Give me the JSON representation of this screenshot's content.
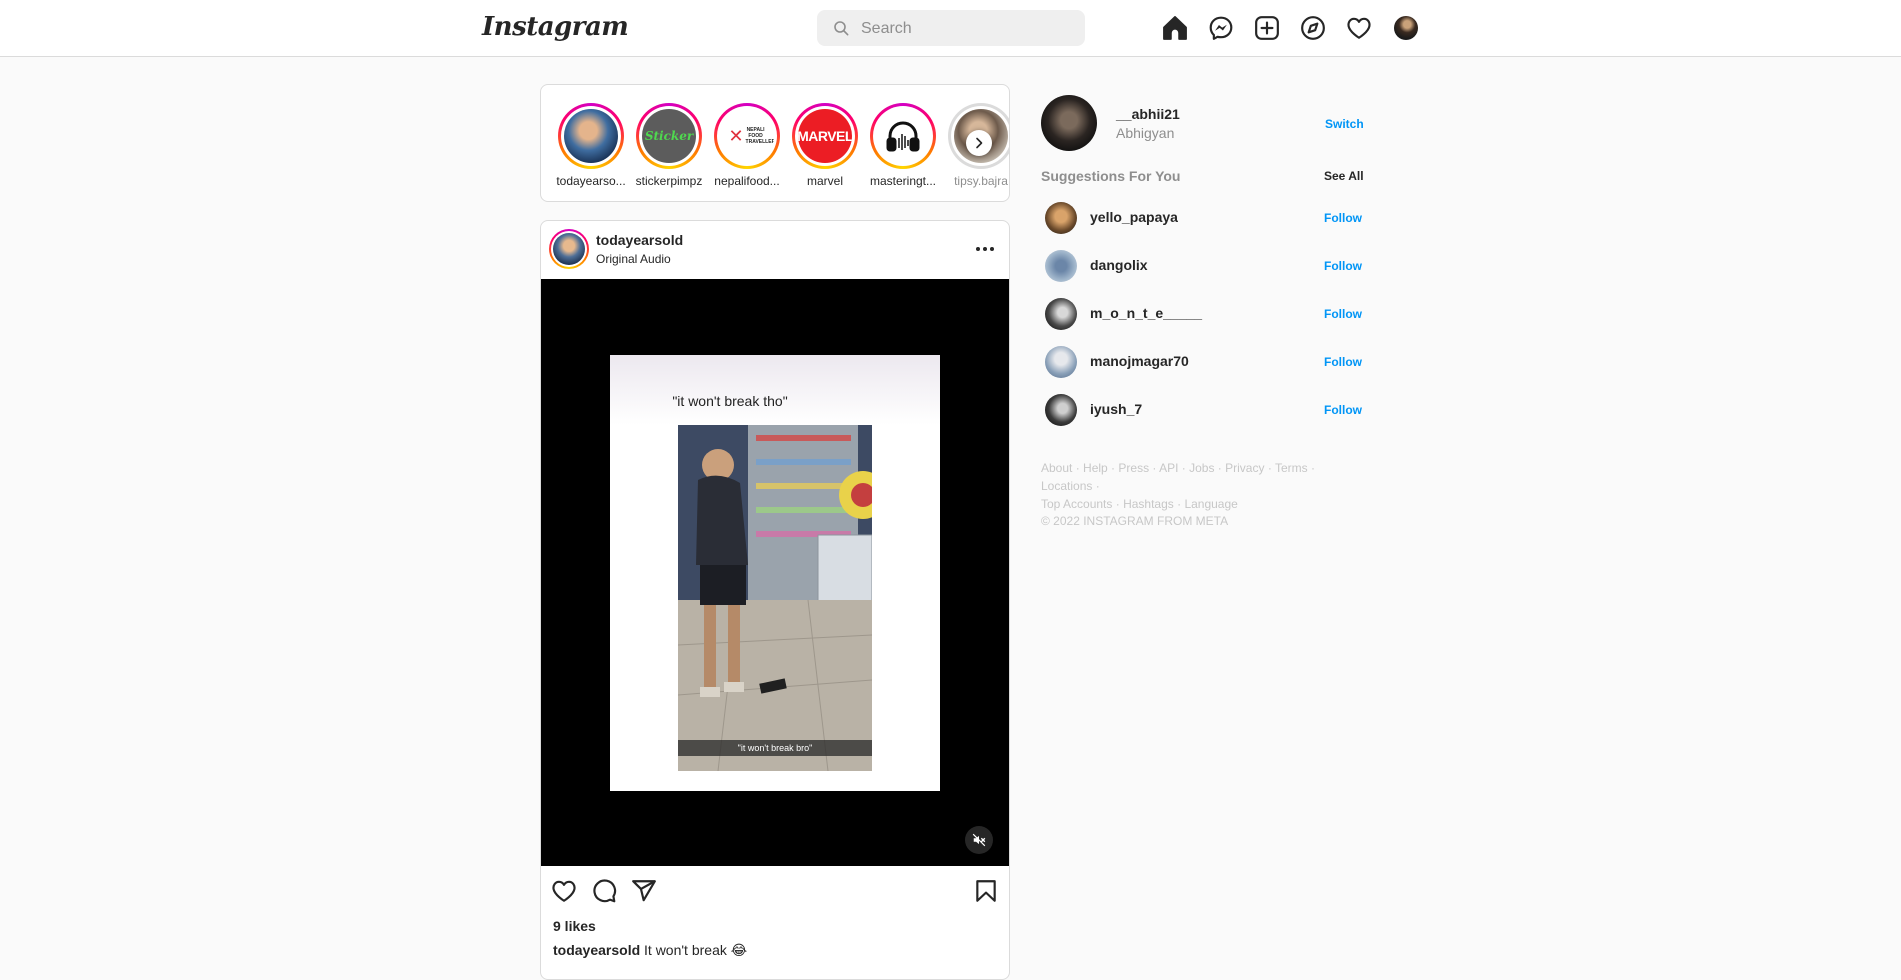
{
  "nav": {
    "logo": "Instagram",
    "search_placeholder": "Search",
    "icons": [
      "home-icon",
      "messenger-icon",
      "new-post-icon",
      "explore-icon",
      "activity-heart-icon",
      "profile-avatar"
    ]
  },
  "stories": [
    {
      "username": "todayearso...",
      "seen": false
    },
    {
      "username": "stickerpimpz",
      "seen": false
    },
    {
      "username": "nepalifood...",
      "seen": false
    },
    {
      "username": "marvel",
      "seen": false
    },
    {
      "username": "masteringt...",
      "seen": false
    },
    {
      "username": "tipsy.bajra",
      "seen": true
    }
  ],
  "story_logos": {
    "stickerpimpz": "Sticker",
    "nepalifood": "NEPALI FOOD TRAVELLER",
    "marvel": "MARVEL"
  },
  "post": {
    "username": "todayearsold",
    "subtitle": "Original Audio",
    "video_top_text": "\"it won't break tho\"",
    "video_subtitle": "\"it won't break bro\"",
    "likes": "9 likes",
    "caption_user": "todayearsold",
    "caption_text": "It won't break 😂"
  },
  "sidebar": {
    "username": "__abhii21",
    "full_name": "Abhigyan",
    "switch_label": "Switch",
    "suggestions_title": "Suggestions For You",
    "see_all_label": "See All",
    "suggestions": [
      {
        "username": "yello_papaya",
        "action": "Follow"
      },
      {
        "username": "dangolix",
        "action": "Follow"
      },
      {
        "username": "m_o_n_t_e_____",
        "action": "Follow"
      },
      {
        "username": "manojmagar70",
        "action": "Follow"
      },
      {
        "username": "iyush_7",
        "action": "Follow"
      }
    ],
    "footer_links": [
      "About",
      "Help",
      "Press",
      "API",
      "Jobs",
      "Privacy",
      "Terms",
      "Locations",
      "Top Accounts",
      "Hashtags",
      "Language"
    ],
    "copyright": "© 2022 INSTAGRAM FROM META"
  },
  "colors": {
    "accent": "#0095f6",
    "border": "#dbdbdb",
    "muted": "#8e8e8e",
    "background": "#fafafa"
  }
}
